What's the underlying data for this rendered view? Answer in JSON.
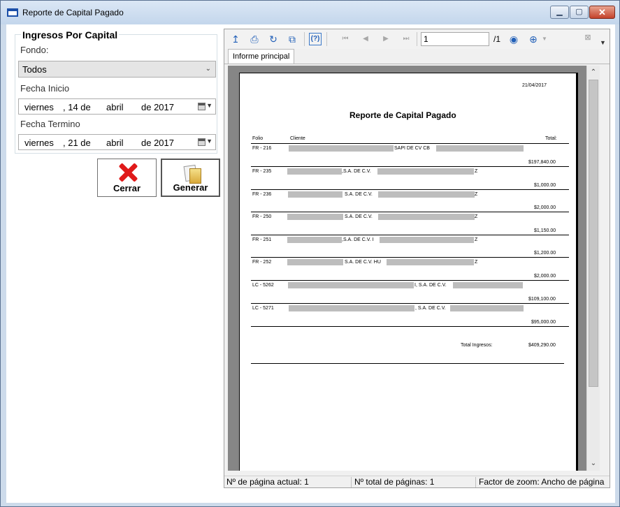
{
  "window": {
    "title": "Reporte de Capital Pagado",
    "min_label": "▁",
    "max_label": "▢",
    "close_label": "✕"
  },
  "left": {
    "group_title": "Ingresos Por Capital",
    "fondo_label": "Fondo:",
    "fondo_value": "Todos",
    "fecha_inicio_label": "Fecha Inicio",
    "fecha_inicio": {
      "weekday": "viernes",
      "day": ", 14 de",
      "month": "abril",
      "year": "de 2017"
    },
    "fecha_termino_label": "Fecha Termino",
    "fecha_termino": {
      "weekday": "viernes",
      "day": ", 21 de",
      "month": "abril",
      "year": "de 2017"
    },
    "cerrar_label": "Cerrar",
    "generar_label": "Generar"
  },
  "viewer": {
    "page_input": "1",
    "page_total": "/1",
    "tab_label": "Informe principal",
    "status_current": "Nº de página actual: 1",
    "status_total": "Nº total de páginas: 1",
    "status_zoom": "Factor de zoom: Ancho de página"
  },
  "report": {
    "date": "21/04/2017",
    "title": "Reporte de Capital Pagado",
    "col_folio": "Folio",
    "col_cliente": "Cliente",
    "col_total": "Total:",
    "rows": [
      {
        "folio": "FR - 216",
        "mid": "SAPI DE CV CB",
        "end": "",
        "total": "$197,840.00"
      },
      {
        "folio": "FR - 235",
        "mid": ",S.A. DE C.V.",
        "end": "Z",
        "total": "$1,000.00"
      },
      {
        "folio": "FR - 236",
        "mid": "S.A. DE C.V.",
        "end": "Z",
        "total": "$2,000.00"
      },
      {
        "folio": "FR - 250",
        "mid": "S.A. DE C.V.",
        "end": "Z",
        "total": "$1,150.00"
      },
      {
        "folio": "FR - 251",
        "mid": ",S.A. DE C.V. I",
        "end": "Z",
        "total": "$1,200.00"
      },
      {
        "folio": "FR - 252",
        "mid": "S.A. DE C.V. HU",
        "end": "Z",
        "total": "$2,000.00"
      },
      {
        "folio": "LC - 5262",
        "mid": "I, S.A. DE C.V.",
        "end": "",
        "total": "$109,100.00"
      },
      {
        "folio": "LC - 5271",
        "mid": ", S.A. DE C.V.",
        "end": "",
        "total": "$95,000.00"
      }
    ],
    "total_label": "Total Ingresos:",
    "total_value": "$409,290.00"
  }
}
